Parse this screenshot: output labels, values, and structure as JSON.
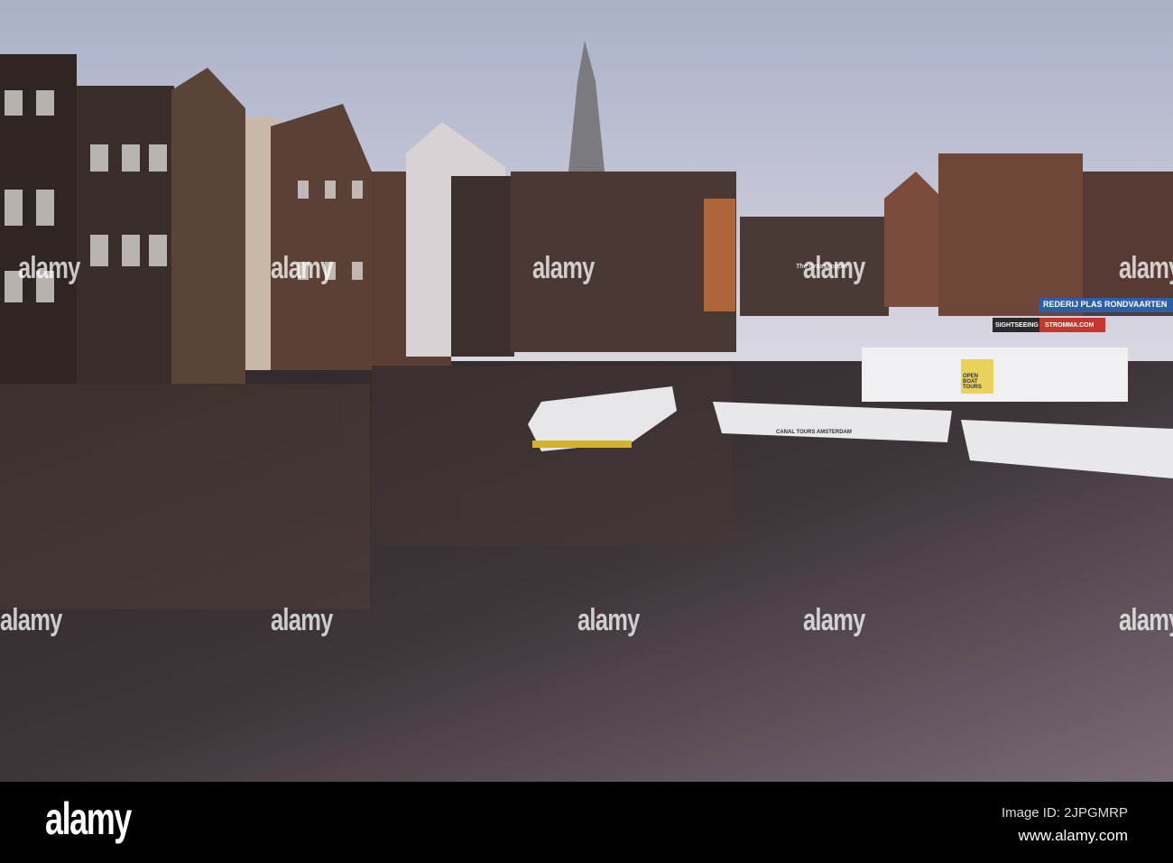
{
  "photo": {
    "signs": {
      "sightseeing": "SIGHTSEEING",
      "stromma": "STROMMA.COM",
      "rederij": "REDERIJ PLAS RONDVAARTEN",
      "open_boat": "OPEN BOAT TOURS",
      "canal_tours": "CANAL TOURS AMSTERDAM",
      "grasshopper": "The Grasshopper"
    },
    "colors": {
      "sky": "#c9cbdc",
      "water": "#3a3033",
      "bar": "#000000"
    }
  },
  "watermark": "alamy",
  "footer": {
    "logo": "alamy",
    "image_id": "Image ID: 2JPGMRP",
    "url": "www.alamy.com"
  }
}
